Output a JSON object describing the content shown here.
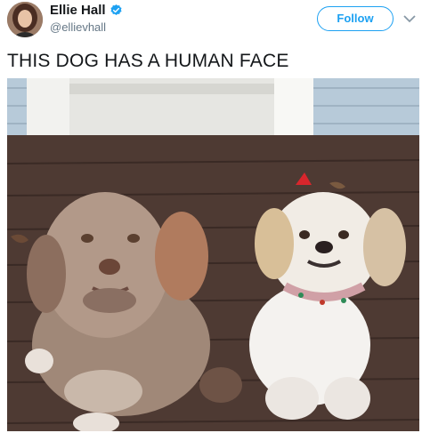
{
  "tweet": {
    "display_name": "Ellie Hall",
    "handle": "@ellievhall",
    "follow_label": "Follow",
    "text": "THIS DOG HAS A HUMAN FACE",
    "verified_icon": "verified-badge-icon",
    "menu_icon": "chevron-down-icon"
  },
  "colors": {
    "accent": "#1da1f2",
    "text": "#14171a",
    "secondary": "#657786"
  }
}
